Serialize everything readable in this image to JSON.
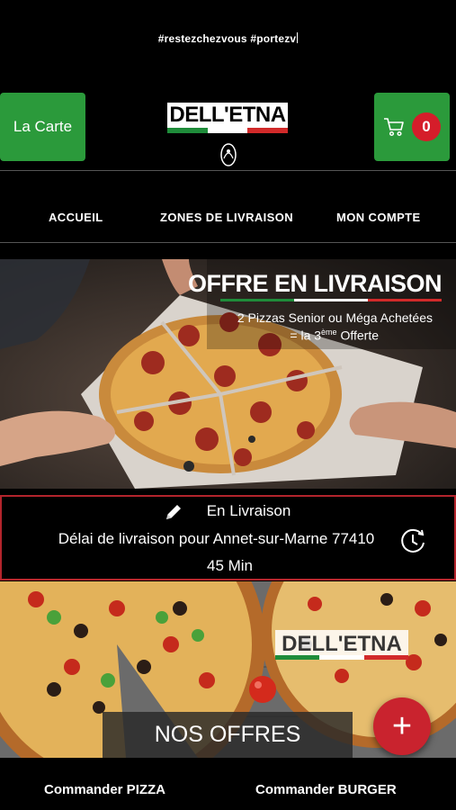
{
  "ticker": {
    "text": "#restezchezvous #portezv"
  },
  "header": {
    "menu_button_label": "La Carte",
    "logo_text": "DELL'ETNA",
    "cart_count": "0"
  },
  "nav": {
    "items": [
      {
        "label": "ACCUEIL"
      },
      {
        "label": "ZONES DE LIVRAISON"
      },
      {
        "label": "MON COMPTE"
      }
    ]
  },
  "banner": {
    "title": "OFFRE EN LIVRAISON",
    "line1": "2 Pizzas Senior ou Méga Achetées",
    "line2_prefix": "= la 3",
    "line2_sup": "ème",
    "line2_suffix": " Offerte"
  },
  "delivery": {
    "mode": "En Livraison",
    "delay_label": "Délai de livraison pour Annet-sur-Marne 77410",
    "delay_value": "45 Min"
  },
  "offers": {
    "logo_text": "DELL'ETNA",
    "button_label": "NOS OFFRES",
    "fab_symbol": "+"
  },
  "bottom_bar": {
    "left_label": "Commander PIZZA",
    "right_label": "Commander BURGER"
  },
  "colors": {
    "brand_green": "#2b9a3b",
    "brand_red": "#d51d2a",
    "flag_green": "#1f8c3a",
    "flag_white": "#ffffff",
    "flag_red": "#d12a2a",
    "delivery_border": "#b3242c"
  },
  "icons": {
    "cart": "shopping-cart-icon",
    "pencil": "pencil-icon",
    "clock": "clock-refresh-icon",
    "plus": "plus-icon"
  }
}
